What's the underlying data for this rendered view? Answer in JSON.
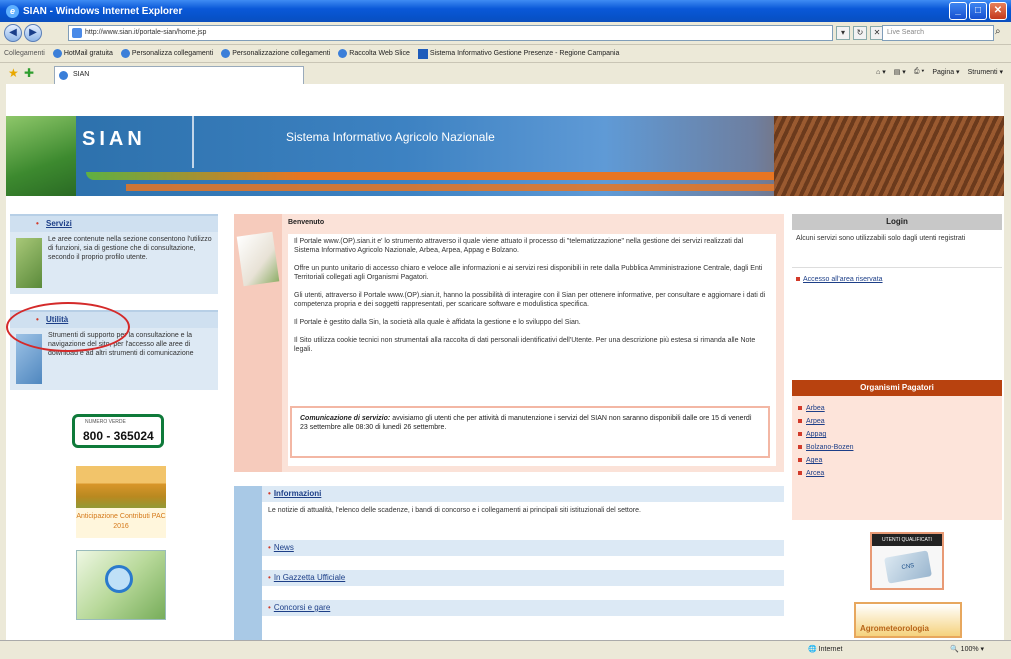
{
  "browser": {
    "title": "SIAN - Windows Internet Explorer",
    "address": "http://www.sian.it/portale-sian/home.jsp",
    "search_placeholder": "Live Search",
    "links_label": "Collegamenti",
    "links": [
      "HotMail gratuita",
      "Personalizza collegamenti",
      "Personalizzazione collegamenti",
      "Raccolta Web Slice",
      "Sistema Informativo Gestione Presenze - Regione Campania"
    ],
    "tab_title": "SIAN",
    "tools": [
      "Pagina ▾",
      "Strumenti ▾"
    ],
    "status_zone": "Internet",
    "status_zoom": "100%"
  },
  "banner": {
    "title": "SIAN",
    "subtitle": "Sistema Informativo Agricolo Nazionale"
  },
  "left": {
    "servizi_title": "Servizi",
    "servizi_text": "Le aree contenute nella sezione consentono l'utilizzo di funzioni, sia di gestione che di consultazione, secondo il proprio profilo utente.",
    "utilita_title": "Utilità",
    "utilita_text": "Strumenti di supporto per la consultazione e la navigazione del sito, per l'accesso alle aree di download e ad altri strumenti di comunicazione",
    "numero_verde_label": "NUMERO VERDE",
    "numero_verde": "800 - 365024",
    "pac_text": "Anticipazione Contributi PAC 2016"
  },
  "center": {
    "welcome_title": "Benvenuto",
    "paragraphs": [
      "Il Portale www.(OP).sian.it e' lo strumento attraverso il quale viene attuato il processo di \"telematizzazione\" nella gestione dei servizi realizzati dal Sistema Informativo Agricolo Nazionale, Arbea, Arpea, Appag e Bolzano.",
      "Offre un punto unitario di accesso chiaro e veloce alle informazioni e ai servizi resi disponibili in rete dalla Pubblica Amministrazione Centrale, dagli Enti Territoriali collegati agli Organismi Pagatori.",
      "Gli utenti, attraverso il Portale www.(OP).sian.it, hanno la possibilità di interagire con il Sian per ottenere informative, per consultare e aggiornare i dati di competenza propria e dei soggetti rappresentati, per scaricare software e modulistica specifica.",
      "Il Portale è gestito dalla Sin, la società alla quale è affidata la gestione e lo sviluppo del Sian.",
      "Il Sito utilizza cookie tecnici non strumentali alla raccolta di dati personali identificativi dell'Utente. Per una descrizione più estesa si rimanda alle Note legali."
    ],
    "comm_label": "Comunicazione di servizio:",
    "comm_text": "avvisiamo gli utenti che per attività di manutenzione i servizi del SIAN non saranno disponibili dalle ore 15 di venerdì 23 settembre alle 08:30 di lunedì 26 settembre.",
    "info_title": "Informazioni",
    "info_text": "Le notizie di attualità, l'elenco delle scadenze, i bandi di concorso e i collegamenti ai principali siti istituzionali del settore.",
    "news": "News",
    "gazzetta": "In Gazzetta Ufficiale",
    "concorsi": "Concorsi e gare"
  },
  "right": {
    "login_title": "Login",
    "login_text": "Alcuni servizi sono utilizzabili solo dagli utenti registrati",
    "login_link": "Accesso all'area riservata",
    "org_title": "Organismi Pagatori",
    "org_items": [
      "Arbea",
      "Arpea",
      "Appag",
      "Bolzano-Bozen",
      "Agea",
      "Arcea"
    ],
    "card_top": "UTENTI QUALIFICATI",
    "card_chip": "CNS",
    "agro": "Agrometeorologia"
  }
}
